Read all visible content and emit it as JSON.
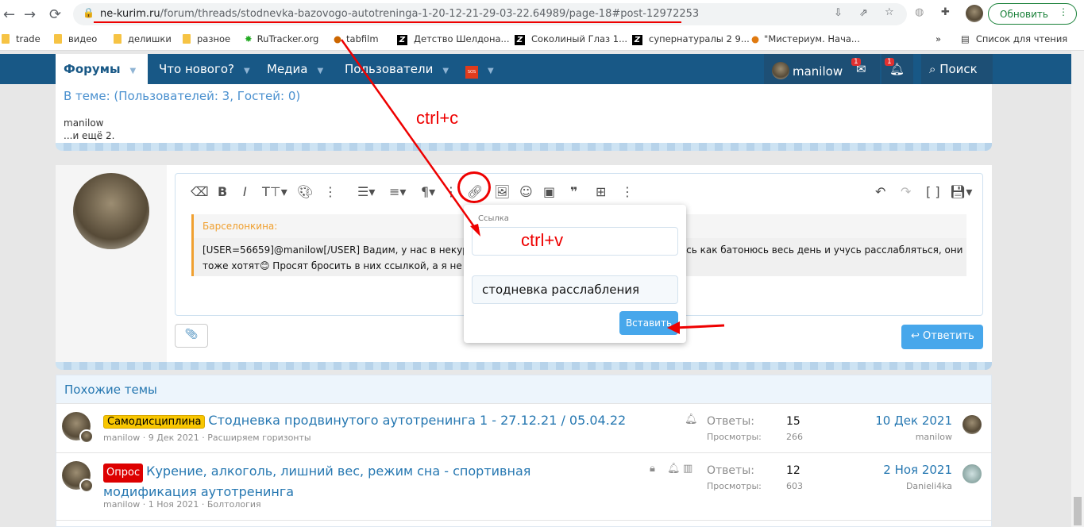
{
  "browser": {
    "url_domain": "ne-kurim.ru",
    "url_path": "/forum/threads/stodnevka-bazovogo-autotreninga-1-20-12-21-29-03-22.64989/page-18#post-12972253",
    "update_button": "Обновить",
    "bookmarks": [
      {
        "label": "trade",
        "icon": "folder-icon"
      },
      {
        "label": "видео",
        "icon": "folder-icon"
      },
      {
        "label": "делишки",
        "icon": "folder-icon"
      },
      {
        "label": "разное",
        "icon": "folder-icon"
      },
      {
        "label": "RuTracker.org",
        "icon": "rutracker-icon"
      },
      {
        "label": "tabfilm",
        "icon": "tabfilm-icon"
      },
      {
        "label": "Детство Шелдона...",
        "icon": "z-icon"
      },
      {
        "label": "Соколиный Глаз 1...",
        "icon": "z-icon"
      },
      {
        "label": "супернатуралы 2 9...",
        "icon": "z-icon"
      },
      {
        "label": "\"Мистериум. Нача...",
        "icon": "orange-icon"
      }
    ],
    "more": "»",
    "reading_list": "Список для чтения"
  },
  "nav": {
    "tabs": [
      "Форумы",
      "Что нового?",
      "Медиа",
      "Пользователи"
    ],
    "sos": "SOS",
    "username": "manilow",
    "messages_badge": "1",
    "alerts_badge": "1",
    "search": "Поиск"
  },
  "in_thread": {
    "title": "В теме: (Пользователей: 3, Гостей: 0)",
    "user": "manilow",
    "more": "...и ещё 2."
  },
  "editor": {
    "quote_author": "Барселонкина:",
    "quote_text_1": "[USER=56659]@manilow[/USER] Вадим, у нас в некуряш",
    "quote_text_1b": "юсь как батонюсь весь день и учусь расслабляться, они",
    "quote_text_2": "тоже хотят😊 Просят бросить в них ссылкой, а я не уме",
    "reply_button": "Ответить"
  },
  "link_popup": {
    "url_label": "Ссылка",
    "url_value": "",
    "text_value": "стодневка расслабления",
    "insert_button": "Вставить"
  },
  "annotations": {
    "copy": "ctrl+c",
    "paste": "ctrl+v"
  },
  "similar": {
    "title": "Похожие темы",
    "replies_label": "Ответы:",
    "views_label": "Просмотры:",
    "topics": [
      {
        "prefix": "Самодисциплина",
        "prefix_color": "#f8c600",
        "title": "Стодневка продвинутого аутотренинга 1 - 27.12.21 / 05.04.22",
        "author": "manilow",
        "date": "9 Дек 2021",
        "forum": "Расширяем горизонты",
        "replies": "15",
        "views": "266",
        "last_date": "10 Дек 2021",
        "last_user": "manilow"
      },
      {
        "prefix": "Опрос",
        "prefix_color": "#dd0000",
        "title": "Курение, алкоголь, лишний вес, режим сна - спортивная модификация аутотренинга",
        "author": "manilow",
        "date": "1 Ноя 2021",
        "forum": "Болтология",
        "replies": "12",
        "views": "603",
        "last_date": "2 Ноя 2021",
        "last_user": "Danieli4ka"
      }
    ]
  }
}
